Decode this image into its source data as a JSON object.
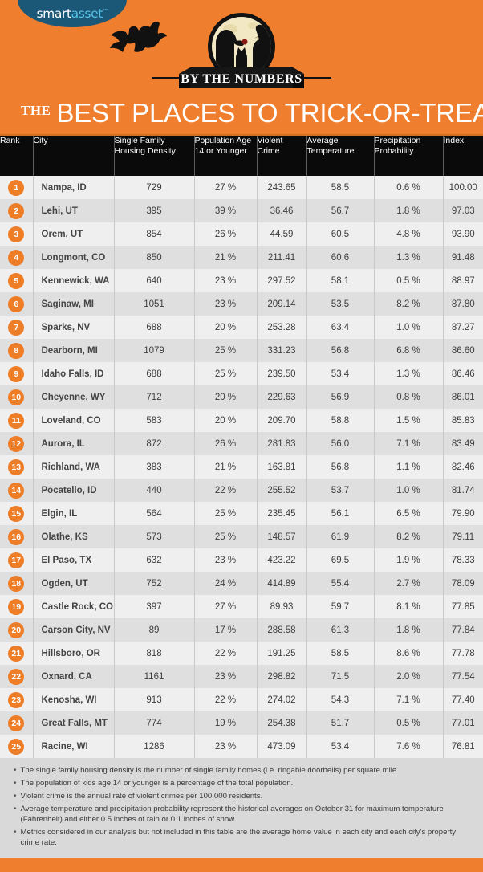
{
  "brand": {
    "logo_smart": "smart",
    "logo_asset": "asset",
    "logo_tm": "™"
  },
  "header": {
    "badge_label": "BY THE NUMBERS",
    "title_the": "THE",
    "title_main": "BEST PLACES TO TRICK-OR-TREAT",
    "background_color": "#EF7E2E",
    "accent_color": "#EE7D28"
  },
  "table": {
    "columns": [
      "Rank",
      "City",
      "Single Family Housing Density",
      "Population Age 14 or Younger",
      "Violent Crime",
      "Average Temperature",
      "Precipitation Probability",
      "Index"
    ],
    "rows": [
      {
        "rank": "1",
        "city": "Nampa, ID",
        "density": "729",
        "population": "27 %",
        "violent_crime": "243.65",
        "temperature": "58.5",
        "precipitation": "0.6 %",
        "index": "100.00"
      },
      {
        "rank": "2",
        "city": "Lehi, UT",
        "density": "395",
        "population": "39 %",
        "violent_crime": "36.46",
        "temperature": "56.7",
        "precipitation": "1.8 %",
        "index": "97.03"
      },
      {
        "rank": "3",
        "city": "Orem, UT",
        "density": "854",
        "population": "26 %",
        "violent_crime": "44.59",
        "temperature": "60.5",
        "precipitation": "4.8 %",
        "index": "93.90"
      },
      {
        "rank": "4",
        "city": "Longmont, CO",
        "density": "850",
        "population": "21 %",
        "violent_crime": "211.41",
        "temperature": "60.6",
        "precipitation": "1.3 %",
        "index": "91.48"
      },
      {
        "rank": "5",
        "city": "Kennewick, WA",
        "density": "640",
        "population": "23 %",
        "violent_crime": "297.52",
        "temperature": "58.1",
        "precipitation": "0.5 %",
        "index": "88.97"
      },
      {
        "rank": "6",
        "city": "Saginaw, MI",
        "density": "1051",
        "population": "23 %",
        "violent_crime": "209.14",
        "temperature": "53.5",
        "precipitation": "8.2 %",
        "index": "87.80"
      },
      {
        "rank": "7",
        "city": "Sparks, NV",
        "density": "688",
        "population": "20 %",
        "violent_crime": "253.28",
        "temperature": "63.4",
        "precipitation": "1.0 %",
        "index": "87.27"
      },
      {
        "rank": "8",
        "city": "Dearborn, MI",
        "density": "1079",
        "population": "25 %",
        "violent_crime": "331.23",
        "temperature": "56.8",
        "precipitation": "6.8 %",
        "index": "86.60"
      },
      {
        "rank": "9",
        "city": "Idaho Falls, ID",
        "density": "688",
        "population": "25 %",
        "violent_crime": "239.50",
        "temperature": "53.4",
        "precipitation": "1.3 %",
        "index": "86.46"
      },
      {
        "rank": "10",
        "city": "Cheyenne, WY",
        "density": "712",
        "population": "20 %",
        "violent_crime": "229.63",
        "temperature": "56.9",
        "precipitation": "0.8 %",
        "index": "86.01"
      },
      {
        "rank": "11",
        "city": "Loveland, CO",
        "density": "583",
        "population": "20 %",
        "violent_crime": "209.70",
        "temperature": "58.8",
        "precipitation": "1.5 %",
        "index": "85.83"
      },
      {
        "rank": "12",
        "city": "Aurora, IL",
        "density": "872",
        "population": "26 %",
        "violent_crime": "281.83",
        "temperature": "56.0",
        "precipitation": "7.1 %",
        "index": "83.49"
      },
      {
        "rank": "13",
        "city": "Richland, WA",
        "density": "383",
        "population": "21 %",
        "violent_crime": "163.81",
        "temperature": "56.8",
        "precipitation": "1.1 %",
        "index": "82.46"
      },
      {
        "rank": "14",
        "city": "Pocatello, ID",
        "density": "440",
        "population": "22 %",
        "violent_crime": "255.52",
        "temperature": "53.7",
        "precipitation": "1.0 %",
        "index": "81.74"
      },
      {
        "rank": "15",
        "city": "Elgin, IL",
        "density": "564",
        "population": "25 %",
        "violent_crime": "235.45",
        "temperature": "56.1",
        "precipitation": "6.5 %",
        "index": "79.90"
      },
      {
        "rank": "16",
        "city": "Olathe, KS",
        "density": "573",
        "population": "25 %",
        "violent_crime": "148.57",
        "temperature": "61.9",
        "precipitation": "8.2 %",
        "index": "79.11"
      },
      {
        "rank": "17",
        "city": "El Paso, TX",
        "density": "632",
        "population": "23 %",
        "violent_crime": "423.22",
        "temperature": "69.5",
        "precipitation": "1.9 %",
        "index": "78.33"
      },
      {
        "rank": "18",
        "city": "Ogden, UT",
        "density": "752",
        "population": "24 %",
        "violent_crime": "414.89",
        "temperature": "55.4",
        "precipitation": "2.7 %",
        "index": "78.09"
      },
      {
        "rank": "19",
        "city": "Castle Rock, CO",
        "density": "397",
        "population": "27 %",
        "violent_crime": "89.93",
        "temperature": "59.7",
        "precipitation": "8.1 %",
        "index": "77.85"
      },
      {
        "rank": "20",
        "city": "Carson City, NV",
        "density": "89",
        "population": "17 %",
        "violent_crime": "288.58",
        "temperature": "61.3",
        "precipitation": "1.8 %",
        "index": "77.84"
      },
      {
        "rank": "21",
        "city": "Hillsboro, OR",
        "density": "818",
        "population": "22 %",
        "violent_crime": "191.25",
        "temperature": "58.5",
        "precipitation": "8.6 %",
        "index": "77.78"
      },
      {
        "rank": "22",
        "city": "Oxnard, CA",
        "density": "1161",
        "population": "23 %",
        "violent_crime": "298.82",
        "temperature": "71.5",
        "precipitation": "2.0 %",
        "index": "77.54"
      },
      {
        "rank": "23",
        "city": "Kenosha, WI",
        "density": "913",
        "population": "22 %",
        "violent_crime": "274.02",
        "temperature": "54.3",
        "precipitation": "7.1 %",
        "index": "77.40"
      },
      {
        "rank": "24",
        "city": "Great Falls, MT",
        "density": "774",
        "population": "19 %",
        "violent_crime": "254.38",
        "temperature": "51.7",
        "precipitation": "0.5 %",
        "index": "77.01"
      },
      {
        "rank": "25",
        "city": "Racine, WI",
        "density": "1286",
        "population": "23 %",
        "violent_crime": "473.09",
        "temperature": "53.4",
        "precipitation": "7.6 %",
        "index": "76.81"
      }
    ]
  },
  "footnotes": [
    "The single family housing density is the number of single family homes (i.e. ringable doorbells) per square mile.",
    "The population of kids age 14 or younger is a percentage of the total population.",
    "Violent crime is the annual rate of violent crimes per 100,000 residents.",
    "Average temperature and precipitation probability represent the historical averages on October 31 for maximum temperature (Fahrenheit) and either 0.5 inches of rain or 0.1 inches of snow.",
    "Metrics considered in our analysis but not included in this table are the average home value in each city and each city's property crime rate."
  ],
  "chart_data": {
    "type": "table",
    "title": "THE BEST PLACES TO TRICK-OR-TREAT",
    "columns": [
      "Rank",
      "City",
      "Single Family Housing Density",
      "Population Age 14 or Younger",
      "Violent Crime",
      "Average Temperature",
      "Precipitation Probability",
      "Index"
    ],
    "rows": [
      [
        1,
        "Nampa, ID",
        729,
        27,
        243.65,
        58.5,
        0.6,
        100.0
      ],
      [
        2,
        "Lehi, UT",
        395,
        39,
        36.46,
        56.7,
        1.8,
        97.03
      ],
      [
        3,
        "Orem, UT",
        854,
        26,
        44.59,
        60.5,
        4.8,
        93.9
      ],
      [
        4,
        "Longmont, CO",
        850,
        21,
        211.41,
        60.6,
        1.3,
        91.48
      ],
      [
        5,
        "Kennewick, WA",
        640,
        23,
        297.52,
        58.1,
        0.5,
        88.97
      ],
      [
        6,
        "Saginaw, MI",
        1051,
        23,
        209.14,
        53.5,
        8.2,
        87.8
      ],
      [
        7,
        "Sparks, NV",
        688,
        20,
        253.28,
        63.4,
        1.0,
        87.27
      ],
      [
        8,
        "Dearborn, MI",
        1079,
        25,
        331.23,
        56.8,
        6.8,
        86.6
      ],
      [
        9,
        "Idaho Falls, ID",
        688,
        25,
        239.5,
        53.4,
        1.3,
        86.46
      ],
      [
        10,
        "Cheyenne, WY",
        712,
        20,
        229.63,
        56.9,
        0.8,
        86.01
      ],
      [
        11,
        "Loveland, CO",
        583,
        20,
        209.7,
        58.8,
        1.5,
        85.83
      ],
      [
        12,
        "Aurora, IL",
        872,
        26,
        281.83,
        56.0,
        7.1,
        83.49
      ],
      [
        13,
        "Richland, WA",
        383,
        21,
        163.81,
        56.8,
        1.1,
        82.46
      ],
      [
        14,
        "Pocatello, ID",
        440,
        22,
        255.52,
        53.7,
        1.0,
        81.74
      ],
      [
        15,
        "Elgin, IL",
        564,
        25,
        235.45,
        56.1,
        6.5,
        79.9
      ],
      [
        16,
        "Olathe, KS",
        573,
        25,
        148.57,
        61.9,
        8.2,
        79.11
      ],
      [
        17,
        "El Paso, TX",
        632,
        23,
        423.22,
        69.5,
        1.9,
        78.33
      ],
      [
        18,
        "Ogden, UT",
        752,
        24,
        414.89,
        55.4,
        2.7,
        78.09
      ],
      [
        19,
        "Castle Rock, CO",
        397,
        27,
        89.93,
        59.7,
        8.1,
        77.85
      ],
      [
        20,
        "Carson City, NV",
        89,
        17,
        288.58,
        61.3,
        1.8,
        77.84
      ],
      [
        21,
        "Hillsboro, OR",
        818,
        22,
        191.25,
        58.5,
        8.6,
        77.78
      ],
      [
        22,
        "Oxnard, CA",
        1161,
        23,
        298.82,
        71.5,
        2.0,
        77.54
      ],
      [
        23,
        "Kenosha, WI",
        913,
        22,
        274.02,
        54.3,
        7.1,
        77.4
      ],
      [
        24,
        "Great Falls, MT",
        774,
        19,
        254.38,
        51.7,
        0.5,
        77.01
      ],
      [
        25,
        "Racine, WI",
        1286,
        23,
        473.09,
        53.4,
        7.6,
        76.81
      ]
    ],
    "units": {
      "population": "%",
      "precipitation": "%",
      "violent_crime": "per 100,000 residents",
      "temperature": "degrees Fahrenheit"
    }
  }
}
